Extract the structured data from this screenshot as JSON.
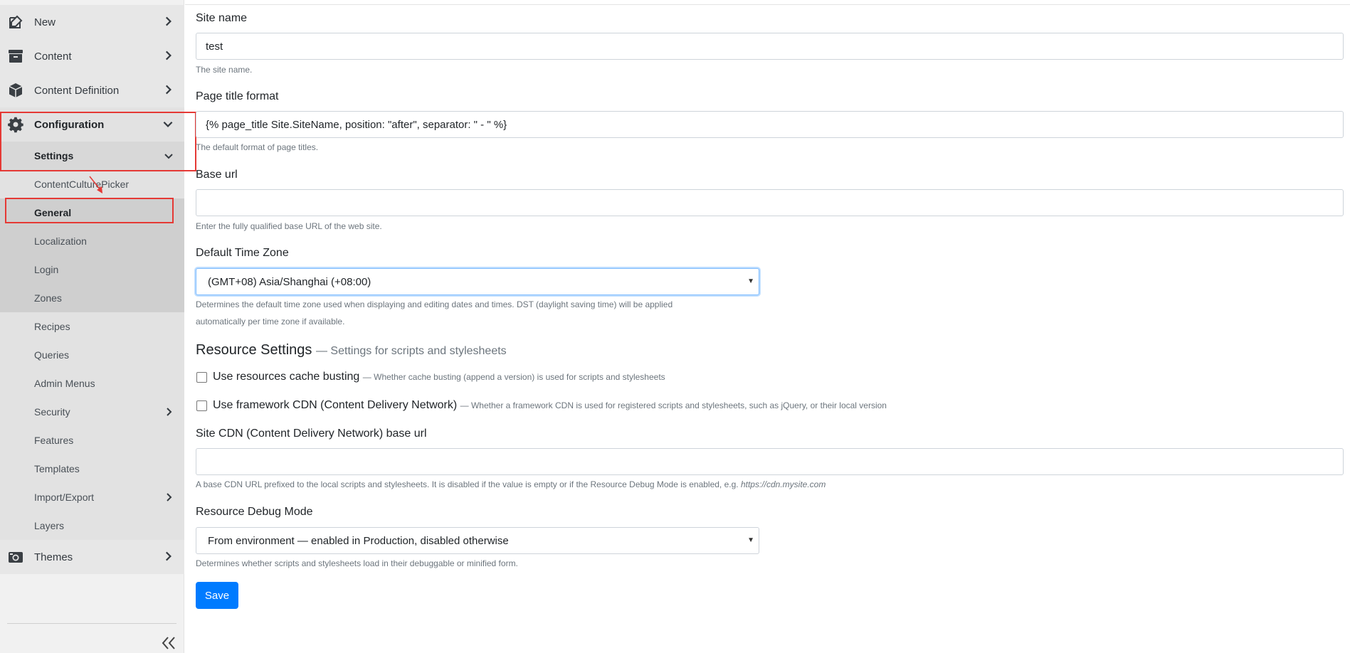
{
  "sidebar": {
    "items": [
      {
        "label": "New",
        "icon": "edit-icon"
      },
      {
        "label": "Content",
        "icon": "archive-icon"
      },
      {
        "label": "Content Definition",
        "icon": "cube-icon"
      },
      {
        "label": "Configuration",
        "icon": "gear-icon"
      },
      {
        "label": "Themes",
        "icon": "camera-icon"
      }
    ],
    "configuration_children": [
      {
        "label": "Settings"
      },
      {
        "label": "ContentCulturePicker"
      },
      {
        "label": "General"
      },
      {
        "label": "Localization"
      },
      {
        "label": "Login"
      },
      {
        "label": "Zones"
      },
      {
        "label": "Recipes"
      },
      {
        "label": "Queries"
      },
      {
        "label": "Admin Menus"
      },
      {
        "label": "Security"
      },
      {
        "label": "Features"
      },
      {
        "label": "Templates"
      },
      {
        "label": "Import/Export"
      },
      {
        "label": "Layers"
      }
    ],
    "collapse_icon": "double-chevron-left-icon"
  },
  "form": {
    "site_name": {
      "label": "Site name",
      "value": "test",
      "help": "The site name."
    },
    "page_title_format": {
      "label": "Page title format",
      "value": "{% page_title Site.SiteName, position: \"after\", separator: \" - \" %}",
      "help": "The default format of page titles."
    },
    "base_url": {
      "label": "Base url",
      "value": "",
      "help": "Enter the fully qualified base URL of the web site."
    },
    "time_zone": {
      "label": "Default Time Zone",
      "value": "(GMT+08) Asia/Shanghai (+08:00)",
      "help_line1": "Determines the default time zone used when displaying and editing dates and times. DST (daylight saving time) will be applied",
      "help_line2": "automatically per time zone if available."
    },
    "resource_settings": {
      "title": "Resource Settings",
      "subtitle": "— Settings for scripts and stylesheets"
    },
    "cache_busting": {
      "label": "Use resources cache busting",
      "hint": "— Whether cache busting (append a version) is used for scripts and stylesheets",
      "checked": false
    },
    "framework_cdn": {
      "label": "Use framework CDN (Content Delivery Network)",
      "hint": "— Whether a framework CDN is used for registered scripts and stylesheets, such as jQuery, or their local version",
      "checked": false
    },
    "site_cdn": {
      "label": "Site CDN (Content Delivery Network) base url",
      "value": "",
      "help": "A base CDN URL prefixed to the local scripts and stylesheets. It is disabled if the value is empty or if the Resource Debug Mode is enabled, e.g.",
      "help_example": "https://cdn.mysite.com"
    },
    "debug_mode": {
      "label": "Resource Debug Mode",
      "value": "From environment — enabled in Production, disabled otherwise",
      "help": "Determines whether scripts and stylesheets load in their debuggable or minified form."
    },
    "save_label": "Save"
  },
  "colors": {
    "accent": "#4a90e2",
    "primary": "#007bff",
    "highlight": "#e53935"
  }
}
